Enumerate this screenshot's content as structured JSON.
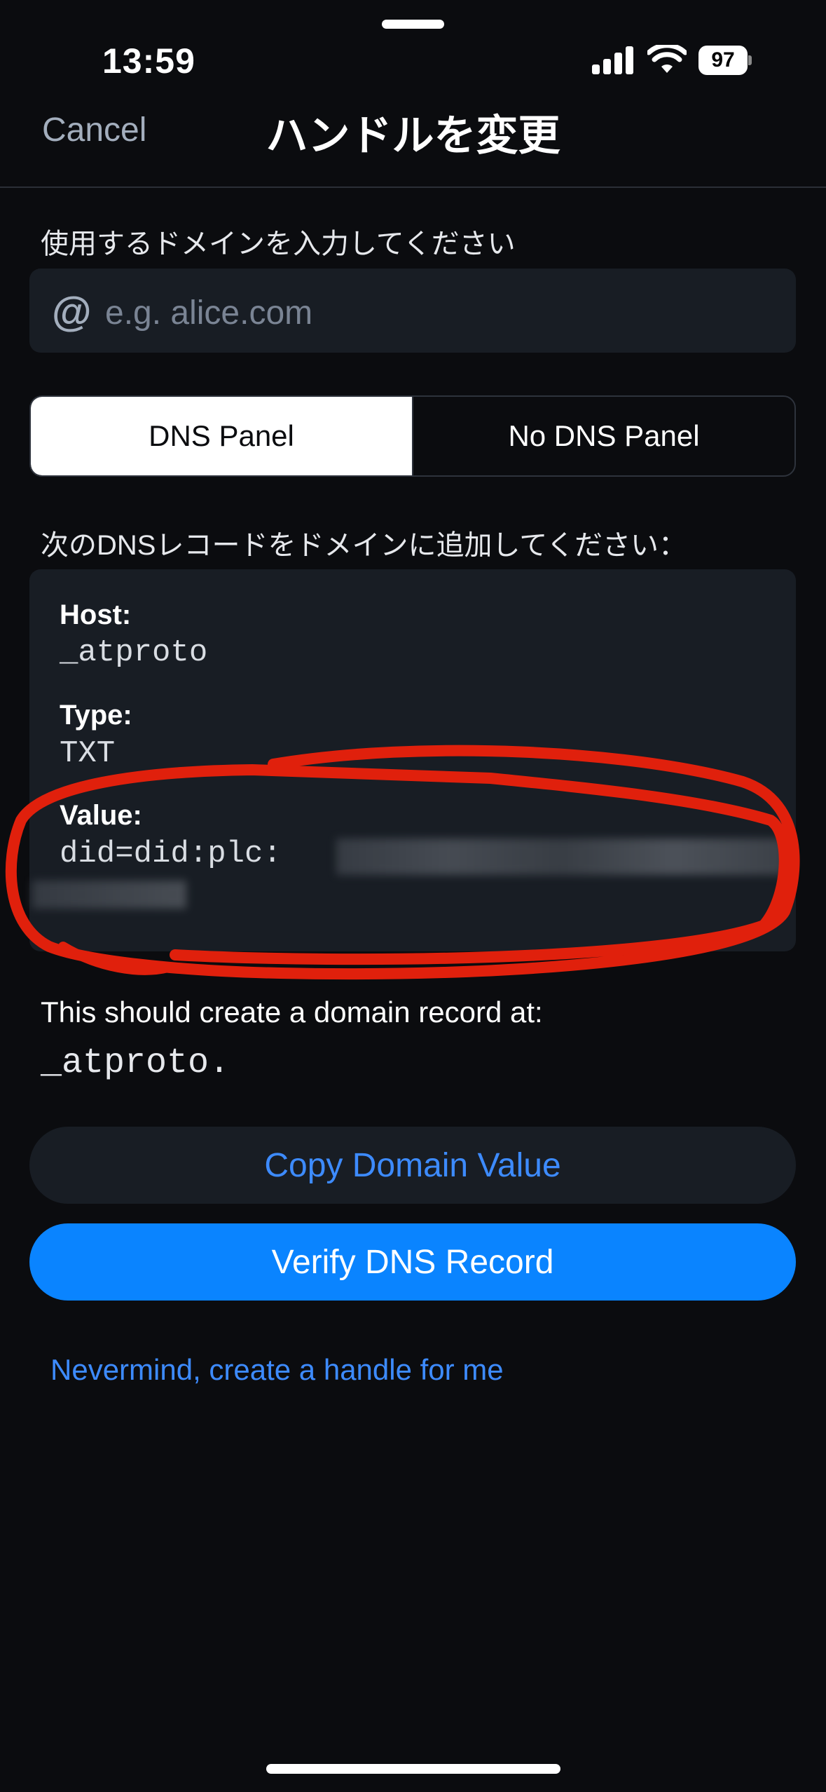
{
  "status": {
    "time": "13:59",
    "battery": "97"
  },
  "header": {
    "cancel_label": "Cancel",
    "title": "ハンドルを変更"
  },
  "domain": {
    "label": "使用するドメインを入力してください",
    "placeholder": "e.g. alice.com",
    "at_symbol": "@"
  },
  "tabs": {
    "dns_panel": "DNS Panel",
    "no_dns_panel": "No DNS Panel",
    "selected": "DNS Panel"
  },
  "records": {
    "instruction": "次のDNSレコードをドメインに追加してください：",
    "host_label": "Host:",
    "host_value": "_atproto",
    "type_label": "Type:",
    "type_value": "TXT",
    "value_label": "Value:",
    "value_value": "did=did:plc:"
  },
  "note": {
    "text": "This should create a domain record at:",
    "domain": "_atproto."
  },
  "buttons": {
    "copy": "Copy Domain Value",
    "verify": "Verify DNS Record"
  },
  "link": {
    "nevermind": "Nevermind, create a handle for me"
  },
  "colors": {
    "background": "#0b0c0f",
    "surface": "#181d24",
    "accent": "#0a84ff",
    "link": "#3d8bff",
    "annotation": "#e0200c"
  }
}
